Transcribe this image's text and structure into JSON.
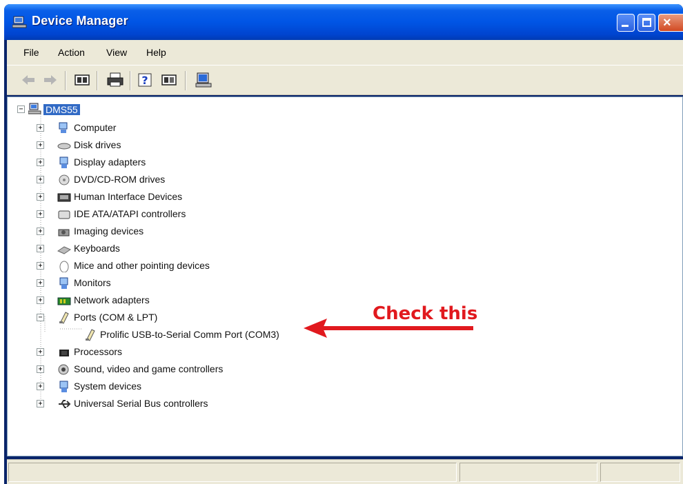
{
  "window": {
    "title": "Device Manager",
    "controls": {
      "minimize": "minimize",
      "maximize": "maximize",
      "close": "×"
    }
  },
  "menu": [
    {
      "label": "File"
    },
    {
      "label": "Action"
    },
    {
      "label": "View"
    },
    {
      "label": "Help"
    }
  ],
  "toolbar": {
    "icons": [
      "back-arrow-icon",
      "forward-arrow-icon",
      "properties-icon",
      "print-icon",
      "help-icon",
      "view-icon",
      "scan-hardware-icon"
    ]
  },
  "tree": {
    "root": {
      "label": "DMS55",
      "expanded": true,
      "selected": true
    },
    "items": [
      {
        "label": "Computer",
        "icon": "computer-icon"
      },
      {
        "label": "Disk drives",
        "icon": "disk-drive-icon"
      },
      {
        "label": "Display adapters",
        "icon": "display-adapter-icon"
      },
      {
        "label": "DVD/CD-ROM drives",
        "icon": "cdrom-icon"
      },
      {
        "label": "Human Interface Devices",
        "icon": "hid-icon"
      },
      {
        "label": "IDE ATA/ATAPI controllers",
        "icon": "ide-controller-icon"
      },
      {
        "label": "Imaging devices",
        "icon": "camera-icon"
      },
      {
        "label": "Keyboards",
        "icon": "keyboard-icon"
      },
      {
        "label": "Mice and other pointing devices",
        "icon": "mouse-icon"
      },
      {
        "label": "Monitors",
        "icon": "monitor-icon"
      },
      {
        "label": "Network adapters",
        "icon": "network-adapter-icon"
      },
      {
        "label": "Ports (COM & LPT)",
        "icon": "port-icon",
        "expanded": true
      },
      {
        "label": "Prolific USB-to-Serial Comm Port (COM3)",
        "icon": "port-icon",
        "child": true
      },
      {
        "label": "Processors",
        "icon": "processor-icon"
      },
      {
        "label": "Sound, video and game controllers",
        "icon": "sound-icon"
      },
      {
        "label": "System devices",
        "icon": "system-device-icon"
      },
      {
        "label": "Universal Serial Bus controllers",
        "icon": "usb-icon"
      }
    ]
  },
  "annotation": {
    "text": "Check this",
    "color": "#e1191e"
  },
  "colors": {
    "titlebar": "#0055e5",
    "chrome": "#ece9d8",
    "selection": "#316ac5"
  }
}
